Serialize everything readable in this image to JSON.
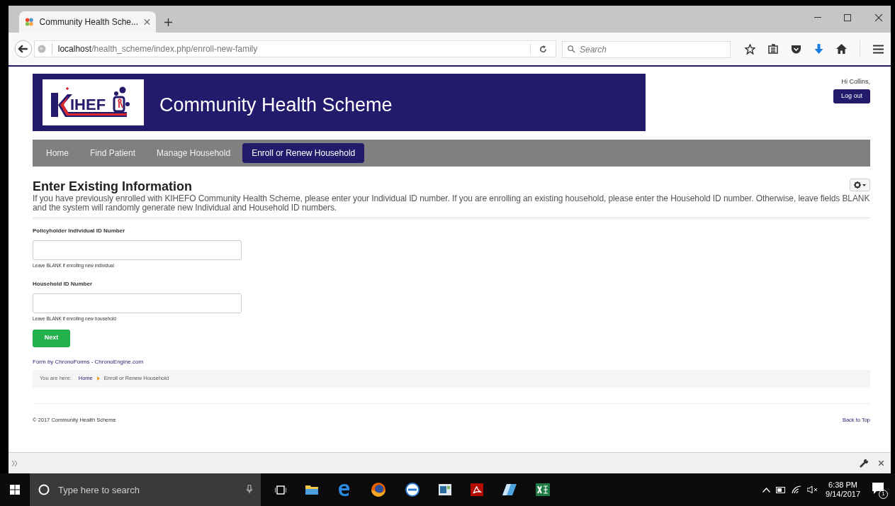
{
  "browser": {
    "tab": {
      "title": "Community Health Sche...",
      "selected": true
    },
    "url": {
      "host": "localhost",
      "path": "/health_scheme/index.php/enroll-new-family"
    },
    "search": {
      "placeholder": "Search"
    }
  },
  "header": {
    "logo_text": "IHEF",
    "site_title": "Community Health Scheme",
    "greeting": "Hi Collins,",
    "logout": "Log out"
  },
  "nav": [
    {
      "label": "Home",
      "selected": false
    },
    {
      "label": "Find Patient",
      "selected": false
    },
    {
      "label": "Manage Household",
      "selected": false
    },
    {
      "label": "Enroll or Renew Household",
      "selected": true
    }
  ],
  "form": {
    "title": "Enter Existing Information",
    "intro": "If you have previously enrolled with KIHEFO Community Health Scheme, please enter your Individual ID number. If you are enrolling an existing household, please enter the Household ID number. Otherwise, leave fields BLANK and the system will randomly generate new Individual and Household ID numbers.",
    "fields": [
      {
        "label": "Policyholder Individual ID Number",
        "help": "Leave BLANK if enrolling new individual"
      },
      {
        "label": "Household ID Number",
        "help": "Leave BLANK if enrolling new household"
      }
    ],
    "submit": "Next",
    "credit": "Form by ChronoForms - ChronoEngine.com"
  },
  "breadcrumb": {
    "prefix": "You are here:",
    "items": [
      "Home",
      "Enroll or Renew Household"
    ]
  },
  "footer": {
    "copyright": "© 2017 Community Health Scheme",
    "back_to_top": "Back to Top"
  },
  "taskbar": {
    "search_placeholder": "Type here to search",
    "time": "6:38 PM",
    "date": "9/14/2017",
    "notifications": "1"
  }
}
